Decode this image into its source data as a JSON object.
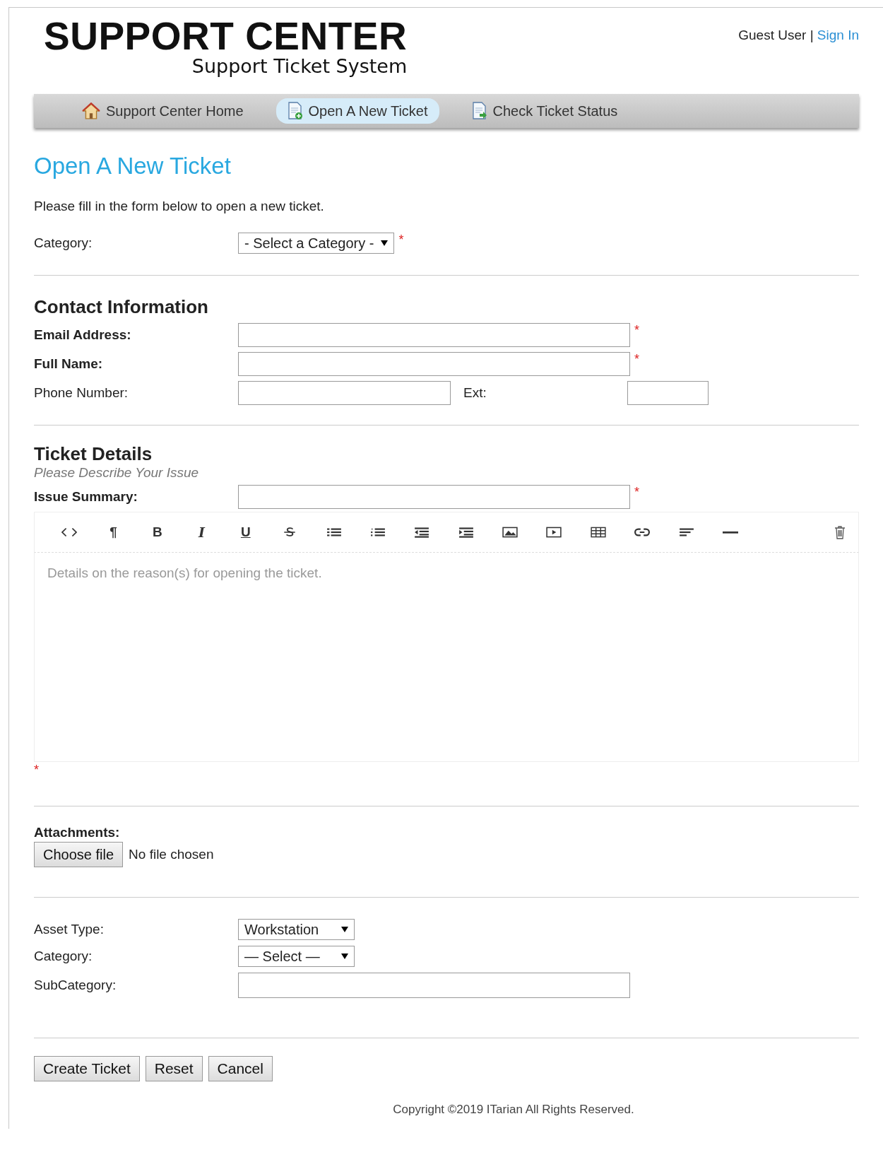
{
  "header": {
    "logo_title": "SUPPORT CENTER",
    "logo_subtitle": "Support Ticket System",
    "user": "Guest User",
    "separator": "|",
    "sign_in": "Sign In"
  },
  "nav": [
    {
      "label": "Support Center Home",
      "kind": "home",
      "selected": false
    },
    {
      "label": "Open A New Ticket",
      "kind": "doc-add",
      "selected": true
    },
    {
      "label": "Check Ticket Status",
      "kind": "doc-arrow",
      "selected": false
    }
  ],
  "page": {
    "title": "Open A New Ticket",
    "intro": "Please fill in the form below to open a new ticket."
  },
  "category": {
    "label": "Category:",
    "value": "- Select a Category -",
    "required_mark": "*"
  },
  "contact": {
    "heading": "Contact Information",
    "fields": [
      {
        "label": "Email Address:",
        "bold": true,
        "kind": "long",
        "required_mark": "*"
      },
      {
        "label": "Full Name:",
        "bold": true,
        "kind": "long",
        "required_mark": "*"
      },
      {
        "label": "Phone Number:",
        "bold": false,
        "kind": "phone",
        "ext_label": "Ext:"
      }
    ]
  },
  "details": {
    "heading": "Ticket Details",
    "subheading": "Please Describe Your Issue",
    "summary_label": "Issue Summary:",
    "summary_required_mark": "*",
    "toolbar": [
      {
        "kind": "code"
      },
      {
        "kind": "text",
        "label": "¶"
      },
      {
        "kind": "text",
        "label": "B"
      },
      {
        "kind": "italic",
        "label": "I"
      },
      {
        "kind": "underline",
        "label": "U"
      },
      {
        "kind": "strike"
      },
      {
        "kind": "ul"
      },
      {
        "kind": "ol"
      },
      {
        "kind": "outdent"
      },
      {
        "kind": "indent"
      },
      {
        "kind": "image"
      },
      {
        "kind": "video"
      },
      {
        "kind": "table"
      },
      {
        "kind": "link"
      },
      {
        "kind": "align"
      },
      {
        "kind": "rule"
      },
      {
        "kind": "trash"
      }
    ],
    "editor_placeholder": "Details on the reason(s) for opening the ticket.",
    "editor_required_mark": "*"
  },
  "attachments": {
    "label": "Attachments:",
    "button": "Choose file",
    "status": "No file chosen"
  },
  "asset": [
    {
      "label": "Asset Type:",
      "kind": "select",
      "value": "Workstation"
    },
    {
      "label": "Category:",
      "kind": "select",
      "value": "— Select —"
    },
    {
      "label": "SubCategory:",
      "kind": "text"
    }
  ],
  "buttons": [
    "Create Ticket",
    "Reset",
    "Cancel"
  ],
  "footer": "Copyright ©2019 ITarian All Rights Reserved."
}
